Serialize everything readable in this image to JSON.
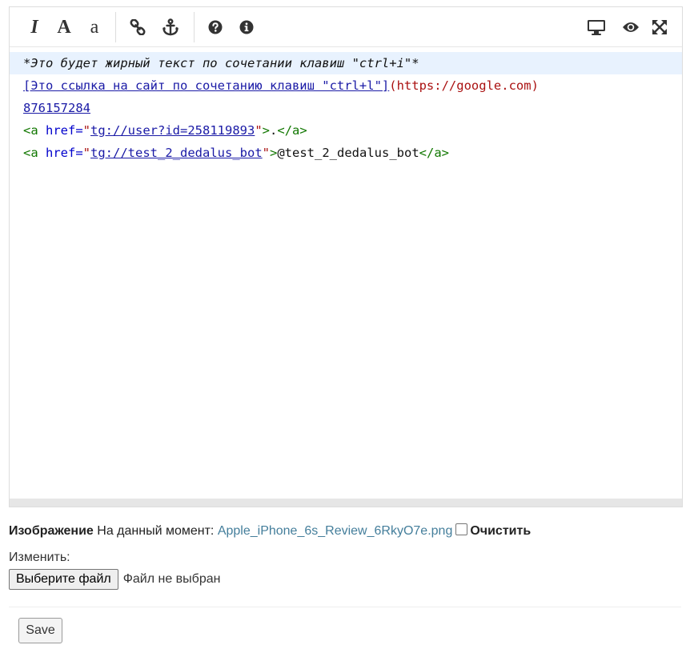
{
  "toolbar": {
    "buttons": [
      {
        "name": "italic-icon",
        "glyph": "I"
      },
      {
        "name": "heading-icon",
        "glyph": "A"
      },
      {
        "name": "text-size-icon",
        "glyph": "a"
      },
      {
        "name": "link-icon"
      },
      {
        "name": "anchor-icon"
      },
      {
        "name": "help-icon"
      },
      {
        "name": "info-icon"
      },
      {
        "name": "desktop-icon"
      },
      {
        "name": "preview-eye-icon"
      },
      {
        "name": "fullscreen-icon"
      }
    ]
  },
  "editor": {
    "line1": {
      "text": "*Это будет жирный текст по сочетании клавиш \"ctrl+i\"*"
    },
    "line2": {
      "link": "[Это ссылка на сайт по сочетанию клавиш \"ctrl+l\"]",
      "url": "(https://google.com)"
    },
    "line3": {
      "number": "876157284"
    },
    "line4": {
      "open": "<a",
      "attr": " href=",
      "q1": "\"",
      "href": "tg://user?id=258119893",
      "q2": "\"",
      "close": ">",
      "text": ".",
      "end": "</a>"
    },
    "line5": {
      "open": "<a",
      "attr": " href=",
      "q1": "\"",
      "href": "tg://test_2_dedalus_bot",
      "q2": "\"",
      "close": ">",
      "text": "@test_2_dedalus_bot",
      "end": "</a>"
    }
  },
  "form": {
    "image_label": "Изображение",
    "current_label": "На данный момент:",
    "current_file": "Apple_iPhone_6s_Review_6RkyO7e.png",
    "clear_label": "Очистить",
    "change_label": "Изменить:",
    "choose_file": "Выберите файл",
    "no_file": "Файл не выбран",
    "save": "Save"
  }
}
